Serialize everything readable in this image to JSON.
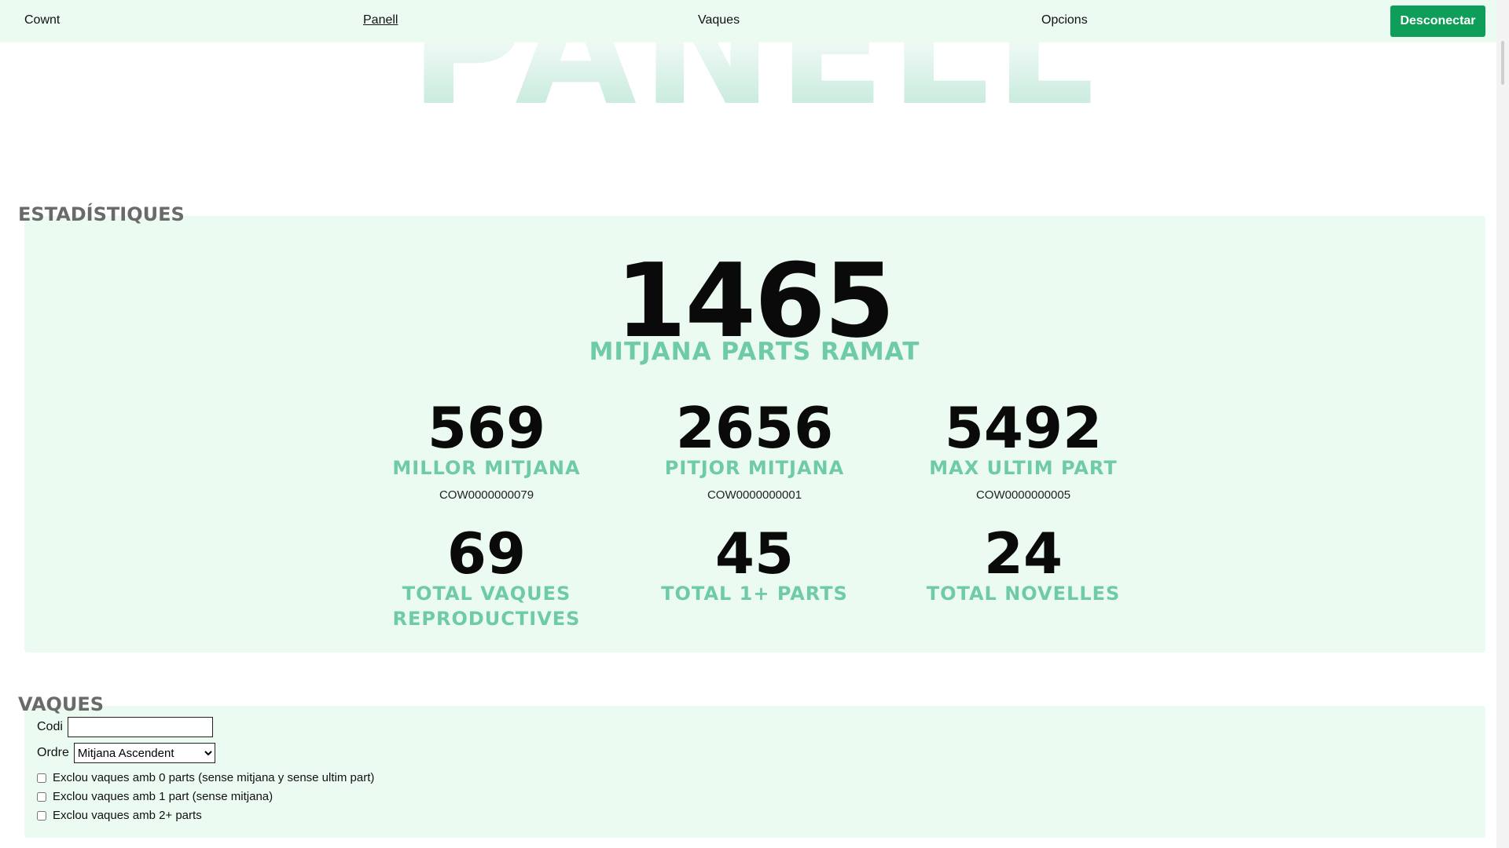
{
  "nav": {
    "brand": "Cownt",
    "items": [
      "Panell",
      "Vaques",
      "Opcions"
    ],
    "logout_label": "Desconectar"
  },
  "hero": {
    "title": "PANELL"
  },
  "stats": {
    "heading": "ESTADÍSTIQUES",
    "main": {
      "value": "1465",
      "label": "MITJANA PARTS RAMAT"
    },
    "cards": [
      {
        "value": "569",
        "label": "MILLOR MITJANA",
        "sub": "COW0000000079"
      },
      {
        "value": "2656",
        "label": "PITJOR MITJANA",
        "sub": "COW0000000001"
      },
      {
        "value": "5492",
        "label": "MAX ULTIM PART",
        "sub": "COW0000000005"
      },
      {
        "value": "69",
        "label": "TOTAL VAQUES REPRODUCTIVES"
      },
      {
        "value": "45",
        "label": "TOTAL 1+ PARTS"
      },
      {
        "value": "24",
        "label": "TOTAL NOVELLES"
      }
    ]
  },
  "vaques": {
    "heading": "VAQUES",
    "code_label": "Codi",
    "code_value": "",
    "order_label": "Ordre",
    "order_selected": "Mitjana Ascendent",
    "checkboxes": [
      "Exclou vaques amb 0 parts (sense mitjana y sense ultim part)",
      "Exclou vaques amb 1 part (sense mitjana)",
      "Exclou vaques amb 2+ parts"
    ]
  },
  "colors": {
    "accent": "#0f9d5a",
    "panel_bg": "#ecfbf2",
    "label_green": "#6fcba6"
  }
}
